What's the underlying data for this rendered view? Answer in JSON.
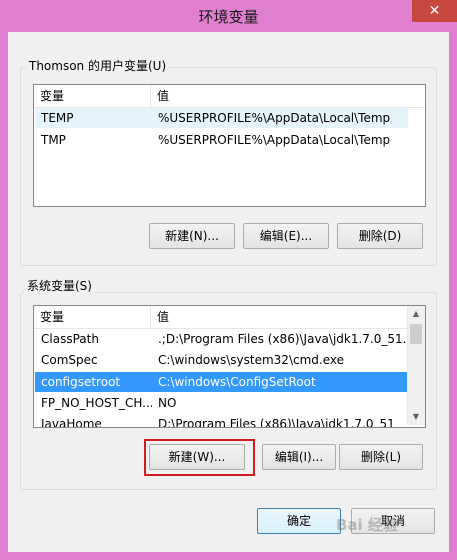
{
  "window": {
    "title": "环境变量",
    "close_symbol": "✕"
  },
  "user_vars": {
    "group_label": "Thomson 的用户变量(U)",
    "columns": [
      "变量",
      "值"
    ],
    "rows": [
      {
        "name": "TEMP",
        "value": "%USERPROFILE%\\AppData\\Local\\Temp"
      },
      {
        "name": "TMP",
        "value": "%USERPROFILE%\\AppData\\Local\\Temp"
      }
    ],
    "buttons": {
      "new": "新建(N)...",
      "edit": "编辑(E)...",
      "delete": "删除(D)"
    }
  },
  "system_vars": {
    "group_label": "系统变量(S)",
    "columns": [
      "变量",
      "值"
    ],
    "rows": [
      {
        "name": "ClassPath",
        "value": ".;D:\\Program Files (x86)\\Java\\jdk1.7.0_51..."
      },
      {
        "name": "ComSpec",
        "value": "C:\\windows\\system32\\cmd.exe"
      },
      {
        "name": "configsetroot",
        "value": "C:\\windows\\ConfigSetRoot"
      },
      {
        "name": "FP_NO_HOST_CH...",
        "value": "NO"
      },
      {
        "name": "JavaHome",
        "value": "D:\\Program Files (x86)\\Java\\jdk1.7.0_51"
      }
    ],
    "selected_index": 2,
    "buttons": {
      "new": "新建(W)...",
      "edit": "编辑(I)...",
      "delete": "删除(L)"
    }
  },
  "footer": {
    "ok": "确定",
    "cancel": "取消"
  },
  "watermark": "Bai 经验"
}
